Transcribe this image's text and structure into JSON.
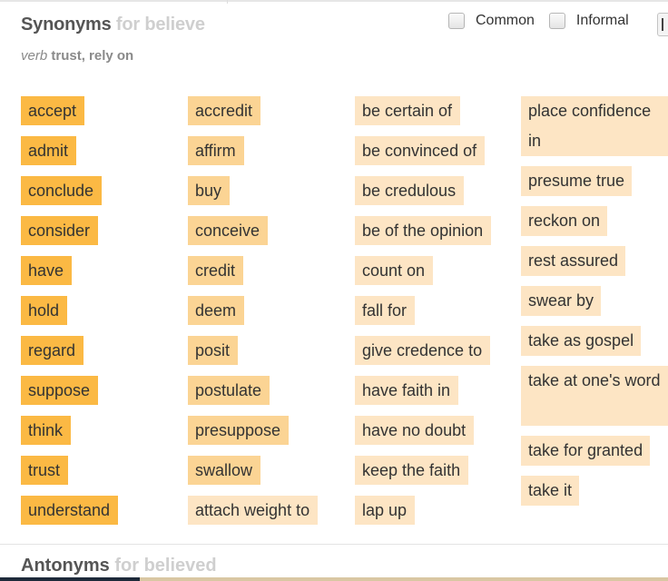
{
  "header": {
    "title": "Synonyms",
    "title_for": "for believe",
    "part_of_speech": "verb",
    "definition": "trust, rely on"
  },
  "filters": [
    {
      "label": "Common",
      "checked": false
    },
    {
      "label": "Informal",
      "checked": false
    }
  ],
  "colors": {
    "relevance_high": "#fbb944",
    "relevance_medium": "#fbd494",
    "relevance_low": "#fde5c4",
    "title": "#555555",
    "title_for": "#cfcfcf"
  },
  "synonyms": {
    "columns": [
      {
        "relevance": "high",
        "words": [
          "accept",
          "admit",
          "conclude",
          "consider",
          "have",
          "hold",
          "regard",
          "suppose",
          "think",
          "trust",
          "understand"
        ]
      },
      {
        "relevance": "medium",
        "words": [
          "accredit",
          "affirm",
          "buy",
          "conceive",
          "credit",
          "deem",
          "posit",
          "postulate",
          "presuppose",
          "swallow",
          "attach weight to"
        ]
      },
      {
        "relevance": "low",
        "words": [
          "be certain of",
          "be convinced of",
          "be credulous",
          "be of the opinion",
          "count on",
          "fall for",
          "give credence to",
          "have faith in",
          "have no doubt",
          "keep the faith",
          "lap up"
        ]
      },
      {
        "relevance": "low",
        "words": [
          "place confidence in",
          "presume true",
          "reckon on",
          "rest assured",
          "swear by",
          "take as gospel",
          "take at one's word",
          "take for granted",
          "take it"
        ]
      }
    ]
  },
  "antonyms": {
    "title": "Antonyms",
    "title_for": "for believed"
  }
}
